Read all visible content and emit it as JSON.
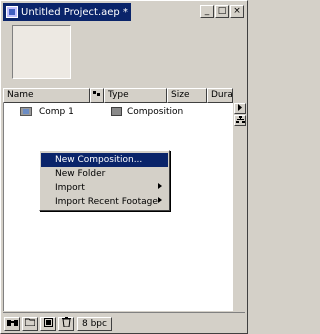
{
  "window": {
    "title": "Untitled Project.aep *",
    "minimize_glyph": "_",
    "maximize_glyph": "□",
    "close_glyph": "×"
  },
  "columns": [
    {
      "label": "Name"
    },
    {
      "label": "Type"
    },
    {
      "label": "Size"
    },
    {
      "label": "Dura"
    }
  ],
  "items": [
    {
      "name": "Comp 1",
      "type": "Composition"
    }
  ],
  "context_menu": {
    "items": [
      {
        "label": "New Composition...",
        "selected": true,
        "submenu": false
      },
      {
        "label": "New Folder",
        "selected": false,
        "submenu": false
      },
      {
        "label": "Import",
        "selected": false,
        "submenu": true
      },
      {
        "label": "Import Recent Footage",
        "selected": false,
        "submenu": true
      }
    ]
  },
  "footer": {
    "bpc_label": "8 bpc"
  },
  "colors": {
    "titlebar": "#0a246a",
    "menu_highlight": "#0a246a",
    "panel": "#d4d0c8"
  }
}
